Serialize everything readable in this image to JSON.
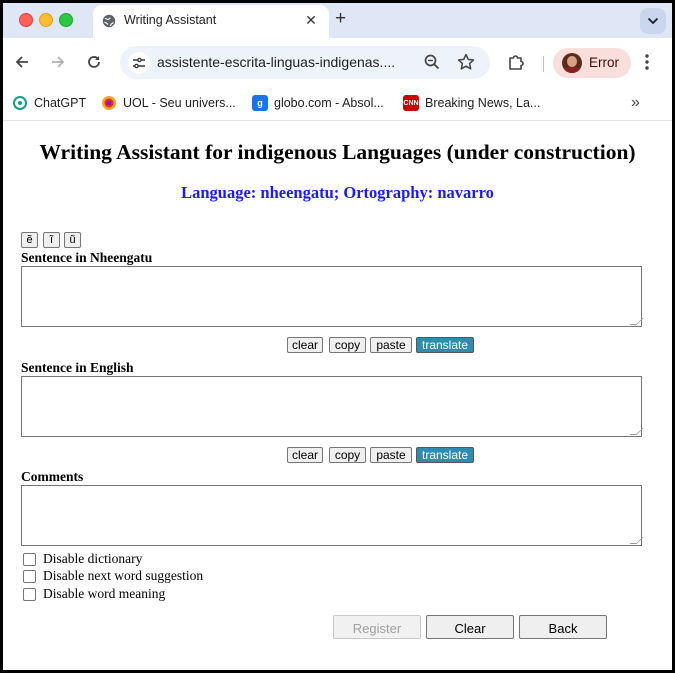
{
  "browser": {
    "tab_title": "Writing Assistant",
    "url": "assistente-escrita-linguas-indigenas....",
    "profile_label": "Error",
    "bookmarks": [
      {
        "label": "ChatGPT",
        "icon": "chatgpt-icon",
        "color": "#10a37f"
      },
      {
        "label": "UOL - Seu univers...",
        "icon": "uol-icon",
        "color": "#f5a623"
      },
      {
        "label": "globo.com - Absol...",
        "icon": "globo-icon",
        "color": "#1a73e8"
      },
      {
        "label": "Breaking News, La...",
        "icon": "cnn-icon",
        "color": "#cc0000"
      }
    ]
  },
  "page": {
    "title": "Writing Assistant for indigenous Languages (under construction)",
    "subtitle": "Language: nheengatu; Ortography: navarro",
    "special_chars": [
      "ẽ",
      "ĩ",
      "ũ"
    ],
    "source_label": "Sentence in Nheengatu",
    "target_label": "Sentence in English",
    "comments_label": "Comments",
    "row_buttons": {
      "clear": "clear",
      "copy": "copy",
      "paste": "paste",
      "translate": "translate"
    },
    "checkboxes": [
      "Disable dictionary",
      "Disable next word suggestion",
      "Disable word meaning"
    ],
    "actions": {
      "register": "Register",
      "clear": "Clear",
      "back": "Back"
    }
  }
}
